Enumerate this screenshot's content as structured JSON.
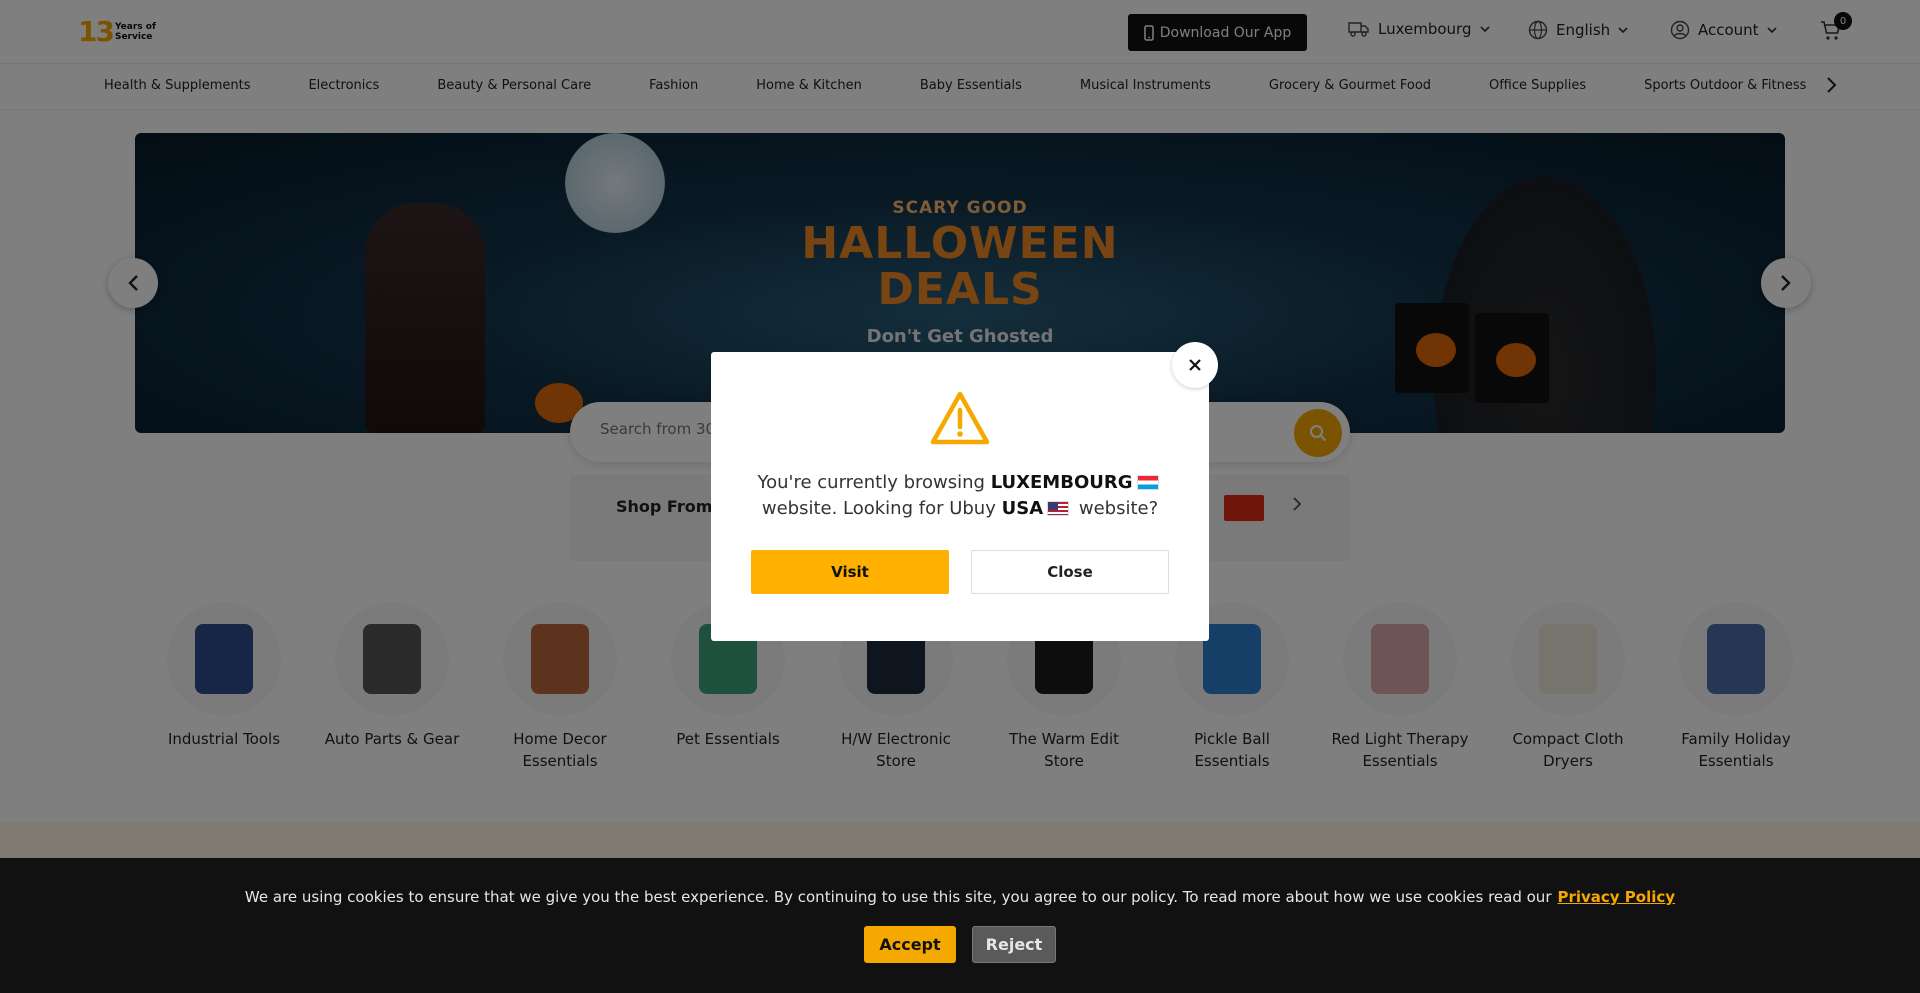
{
  "header": {
    "logo_number": "13",
    "logo_text": "Years of Service",
    "app_button": "Download Our App",
    "country": "Luxembourg",
    "language": "English",
    "account": "Account",
    "cart_count": "0"
  },
  "nav": {
    "categories": [
      "Health & Supplements",
      "Electronics",
      "Beauty & Personal Care",
      "Fashion",
      "Home & Kitchen",
      "Baby Essentials",
      "Musical Instruments",
      "Grocery & Gourmet Food",
      "Office Supplies",
      "Sports Outdoor & Fitness"
    ]
  },
  "banner": {
    "top": "SCARY GOOD",
    "headline_1": "HALLOWEEN",
    "headline_2": "DEALS",
    "tagline": "Don't Get Ghosted"
  },
  "search": {
    "placeholder": "Search from 300 million products"
  },
  "shop_from": {
    "label": "Shop From"
  },
  "categories": [
    {
      "label": "Industrial Tools",
      "color": "#2f4c8c"
    },
    {
      "label": "Auto Parts & Gear",
      "color": "#555555"
    },
    {
      "label": "Home Decor Essentials",
      "color": "#b8673a"
    },
    {
      "label": "Pet Essentials",
      "color": "#3aa07a"
    },
    {
      "label": "H/W Electronic Store",
      "color": "#1c2a3c"
    },
    {
      "label": "The Warm Edit Store",
      "color": "#1a1a1a"
    },
    {
      "label": "Pickle Ball Essentials",
      "color": "#2c7fcf"
    },
    {
      "label": "Red Light Therapy Essentials",
      "color": "#d9a9ae"
    },
    {
      "label": "Compact Cloth Dryers",
      "color": "#efe8dc"
    },
    {
      "label": "Family Holiday Essentials",
      "color": "#4a6fa5"
    }
  ],
  "modal": {
    "text_1": "You're currently browsing",
    "current_country": "LUXEMBOURG",
    "text_2": "website. Looking for Ubuy",
    "suggested_country": "USA",
    "text_3": "website?",
    "visit_label": "Visit",
    "close_label": "Close"
  },
  "cookie": {
    "text": "We are using cookies to ensure that we give you the best experience. By continuing to use this site, you agree to our policy. To read more about how we use cookies read our",
    "link": "Privacy Policy",
    "accept": "Accept",
    "reject": "Reject"
  },
  "colors": {
    "accent": "#f5a800",
    "dark": "#111111"
  }
}
